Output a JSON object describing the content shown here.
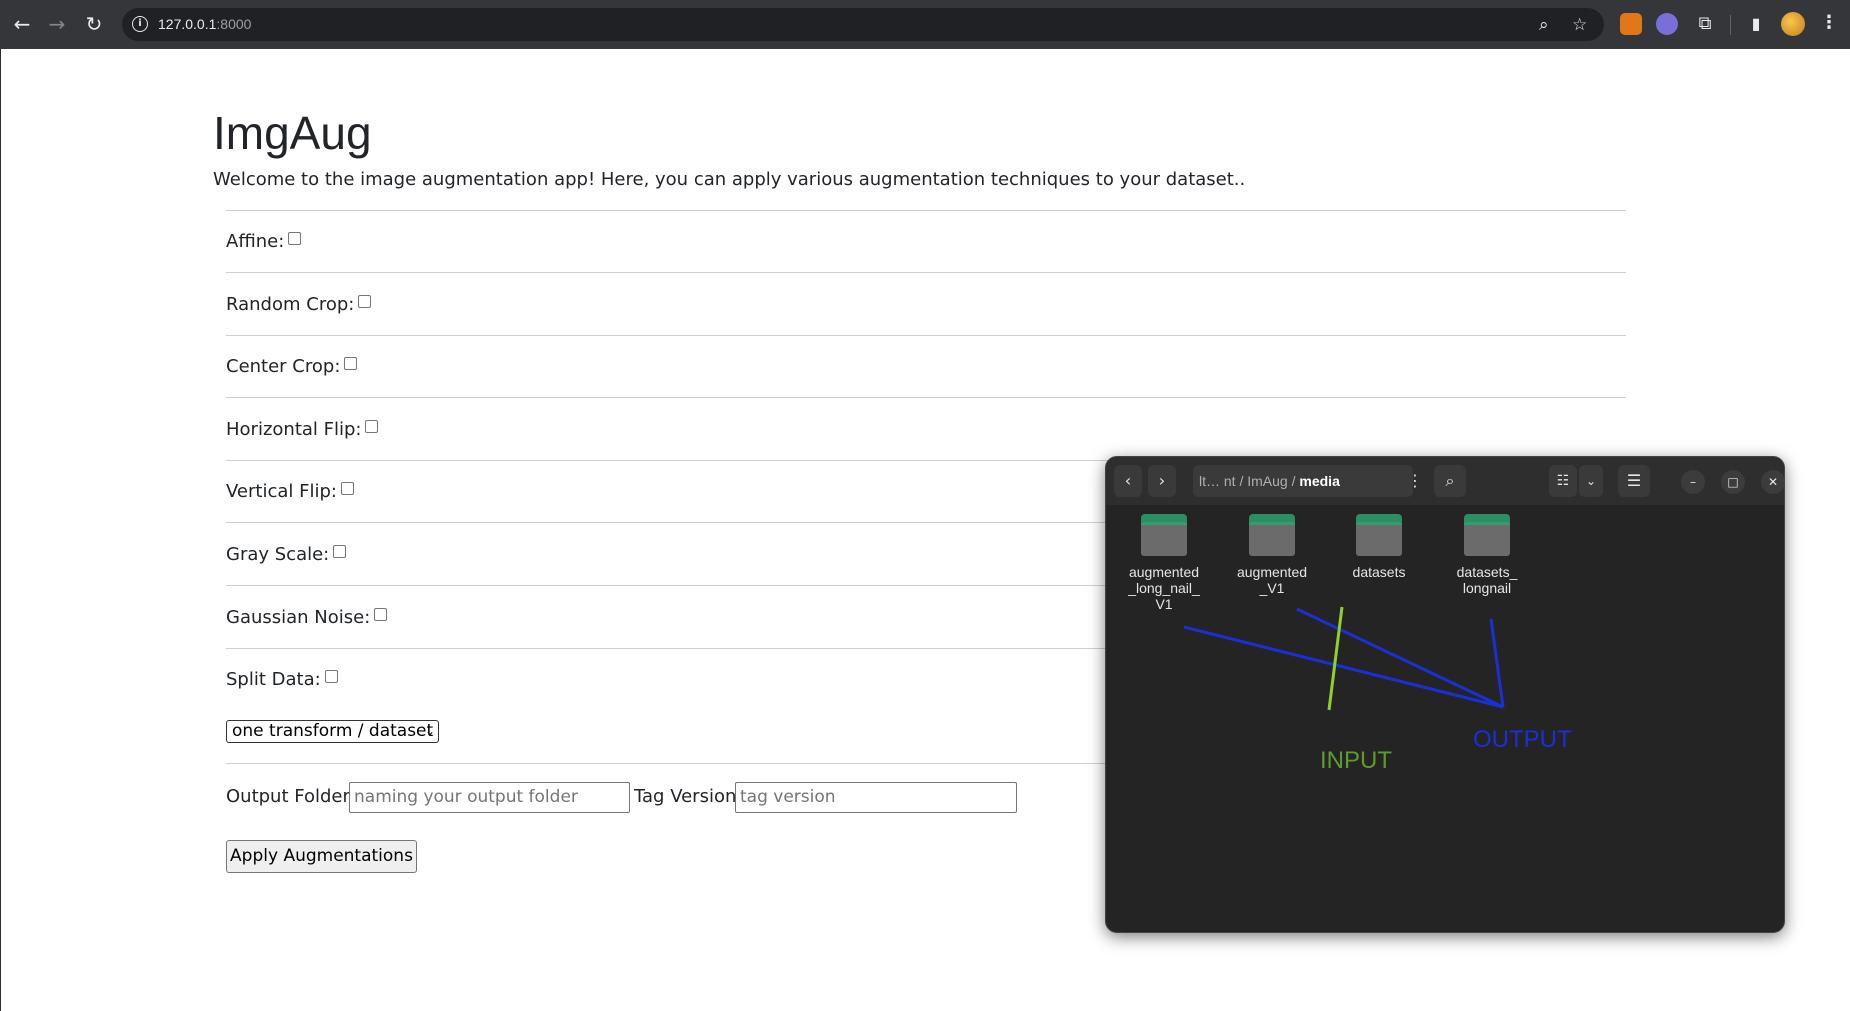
{
  "browser": {
    "url_host": "127.0.0.1",
    "url_port": ":8000",
    "back_icon": "arrow-left-icon",
    "forward_icon": "arrow-right-icon",
    "reload_icon": "reload-icon"
  },
  "page": {
    "title": "ImgAug",
    "subtitle": "Welcome to the image augmentation app! Here, you can apply various augmentation techniques to your dataset..",
    "options": [
      {
        "label": "Affine:",
        "checked": false
      },
      {
        "label": "Random Crop:",
        "checked": false
      },
      {
        "label": "Center Crop:",
        "checked": false
      },
      {
        "label": "Horizontal Flip:",
        "checked": false
      },
      {
        "label": "Vertical Flip:",
        "checked": false
      },
      {
        "label": "Gray Scale:",
        "checked": false
      },
      {
        "label": "Gaussian Noise:",
        "checked": false
      },
      {
        "label": "Split Data:",
        "checked": false
      }
    ],
    "mode_select": "one transform / dataset",
    "output_folder_label": "Output Folder:",
    "output_folder_placeholder": "naming your output folder",
    "tag_version_label": "Tag Version:",
    "tag_version_placeholder": "tag version",
    "apply_button": "Apply Augmentations"
  },
  "file_manager": {
    "path_prefix": "lt… nt",
    "path_sep": "/",
    "path_parent": "ImAug",
    "path_current": "media",
    "folders": [
      {
        "label": "augmented\n_long_nail_\nV1"
      },
      {
        "label": "augmented\n_V1"
      },
      {
        "label": "datasets"
      },
      {
        "label": "datasets_\nlongnail"
      }
    ],
    "annotations": {
      "input_label": "INPUT",
      "output_label": "OUTPUT",
      "input_color": "#8fd12a",
      "output_color": "#1a2fd6"
    }
  }
}
